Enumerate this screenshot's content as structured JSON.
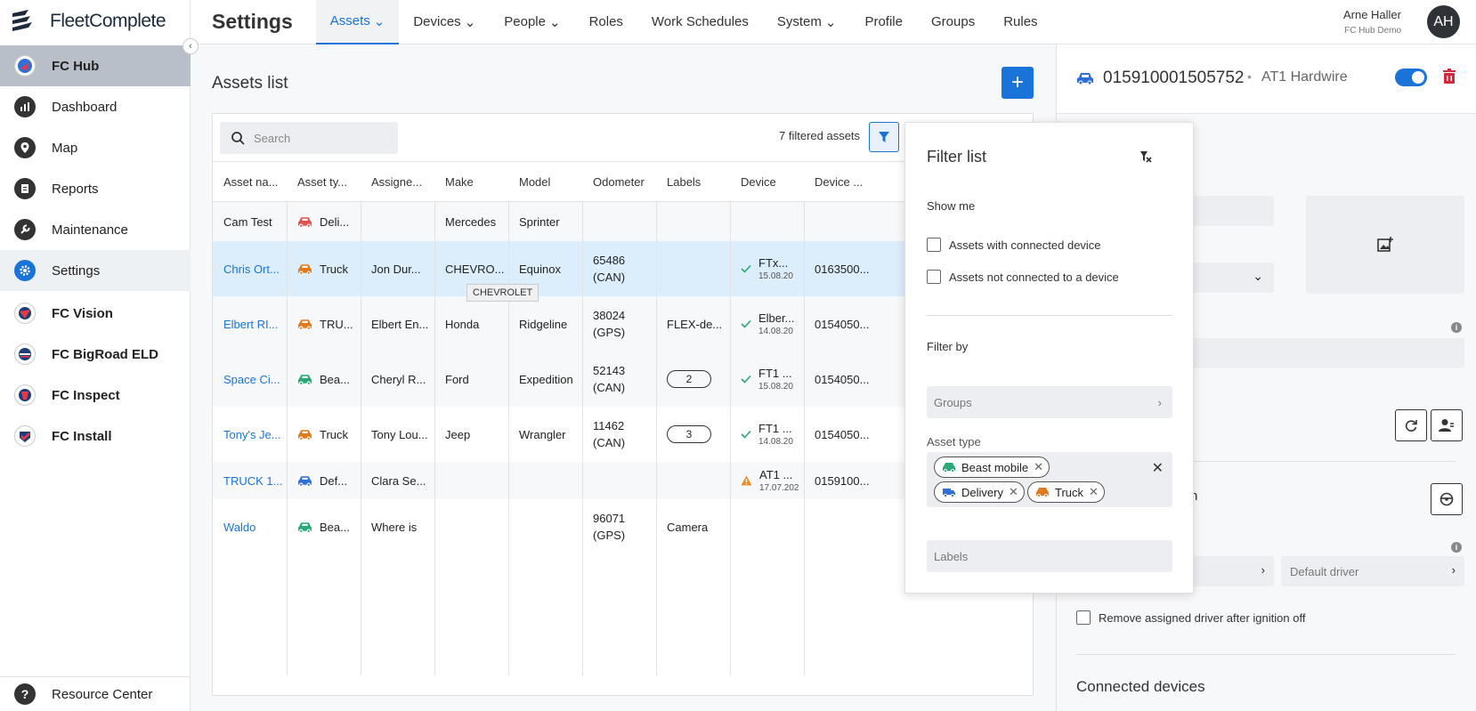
{
  "brand": {
    "name": "FleetComplete"
  },
  "sidebar": {
    "items": [
      {
        "label": "FC Hub",
        "icon": "fc-hub-icon"
      },
      {
        "label": "Dashboard",
        "icon": "dashboard-icon"
      },
      {
        "label": "Map",
        "icon": "map-pin-icon"
      },
      {
        "label": "Reports",
        "icon": "reports-icon"
      },
      {
        "label": "Maintenance",
        "icon": "wrench-icon"
      },
      {
        "label": "Settings",
        "icon": "gear-icon"
      },
      {
        "label": "FC Vision",
        "icon": "fc-vision-icon"
      },
      {
        "label": "FC BigRoad ELD",
        "icon": "fc-bigroad-icon"
      },
      {
        "label": "FC Inspect",
        "icon": "fc-inspect-icon"
      },
      {
        "label": "FC Install",
        "icon": "fc-install-icon"
      }
    ],
    "resource_center": "Resource Center"
  },
  "header": {
    "title": "Settings",
    "tabs": [
      {
        "label": "Assets",
        "dropdown": true,
        "active": true
      },
      {
        "label": "Devices",
        "dropdown": true
      },
      {
        "label": "People",
        "dropdown": true
      },
      {
        "label": "Roles"
      },
      {
        "label": "Work Schedules"
      },
      {
        "label": "System",
        "dropdown": true
      },
      {
        "label": "Profile"
      },
      {
        "label": "Groups"
      },
      {
        "label": "Rules"
      }
    ],
    "user": {
      "name": "Arne Haller",
      "org": "FC Hub Demo",
      "initials": "AH"
    }
  },
  "assets": {
    "title": "Assets list",
    "add_button": "+",
    "search_placeholder": "Search",
    "filtered_count": "7 filtered assets",
    "columns": [
      "Asset na...",
      "Asset ty...",
      "Assigne...",
      "Make",
      "Model",
      "Odometer",
      "Labels",
      "Device",
      "Device ..."
    ],
    "rows": [
      {
        "name": "Cam Test",
        "type": "Deli...",
        "type_color": "#e05252",
        "assignee": "",
        "make": "Mercedes",
        "model": "Sprinter",
        "odo": "",
        "odo_unit": "",
        "labels": "",
        "device": "",
        "device_date": "",
        "device_status": "",
        "device_id": ""
      },
      {
        "name": "Chris Ort...",
        "type": "Truck",
        "type_color": "#e07a1f",
        "assignee": "Jon Dur...",
        "make": "CHEVRO...",
        "model": "Equinox",
        "odo": "65486",
        "odo_unit": "(CAN)",
        "labels": "",
        "device": "FTx...",
        "device_date": "15.08.20",
        "device_status": "ok",
        "device_id": "0163500..."
      },
      {
        "name": "Elbert RI...",
        "type": "TRU...",
        "type_color": "#e07a1f",
        "assignee": "Elbert En...",
        "make": "Honda",
        "model": "Ridgeline",
        "odo": "38024",
        "odo_unit": "(GPS)",
        "labels": "FLEX-de...",
        "device": "Elber...",
        "device_date": "14.08.20",
        "device_status": "ok",
        "device_id": "0154050..."
      },
      {
        "name": "Space Ci...",
        "type": "Bea...",
        "type_color": "#2aa876",
        "assignee": "Cheryl R...",
        "make": "Ford",
        "model": "Expedition",
        "odo": "52143",
        "odo_unit": "(CAN)",
        "labels": "2",
        "device": "FT1 ...",
        "device_date": "15.08.20",
        "device_status": "ok",
        "device_id": "0154050..."
      },
      {
        "name": "Tony's Je...",
        "type": "Truck",
        "type_color": "#e07a1f",
        "assignee": "Tony Lou...",
        "make": "Jeep",
        "model": "Wrangler",
        "odo": "11462",
        "odo_unit": "(CAN)",
        "labels": "3",
        "device": "FT1 ...",
        "device_date": "14.08.20",
        "device_status": "ok",
        "device_id": "0154050..."
      },
      {
        "name": "TRUCK 1...",
        "type": "Def...",
        "type_color": "#2f6fd6",
        "assignee": "Clara Se...",
        "make": "",
        "model": "",
        "odo": "",
        "odo_unit": "",
        "labels": "",
        "device": "AT1 ...",
        "device_date": "17.07.202",
        "device_status": "warn",
        "device_id": "0159100..."
      },
      {
        "name": "Waldo",
        "type": "Bea...",
        "type_color": "#2aa876",
        "assignee": "Where is",
        "make": "",
        "model": "",
        "odo": "96071",
        "odo_unit": "(GPS)",
        "labels": "Camera",
        "device": "",
        "device_date": "",
        "device_status": "",
        "device_id": ""
      }
    ],
    "tooltip": "CHEVROLET"
  },
  "filter": {
    "title": "Filter list",
    "show_me": "Show me",
    "opt_connected": "Assets with connected device",
    "opt_not_connected": "Assets not connected to a device",
    "filter_by": "Filter by",
    "groups": "Groups",
    "asset_type_label": "Asset type",
    "chips": [
      {
        "label": "Beast mobile",
        "color": "#2aa876"
      },
      {
        "label": "Delivery",
        "color": "#2f6fd6"
      },
      {
        "label": "Truck",
        "color": "#e07a1f"
      }
    ],
    "labels": "Labels"
  },
  "detail": {
    "asset_id": "015910001505752",
    "separator": "•",
    "device_type": "AT1 Hardwire",
    "enabled": true,
    "default_driver": "Default driver",
    "remove_driver_option": "Remove assigned driver after ignition off",
    "connected_devices": "Connected devices",
    "partial_text": "n"
  },
  "colors": {
    "accent": "#1a73d9",
    "danger": "#d6283a"
  }
}
